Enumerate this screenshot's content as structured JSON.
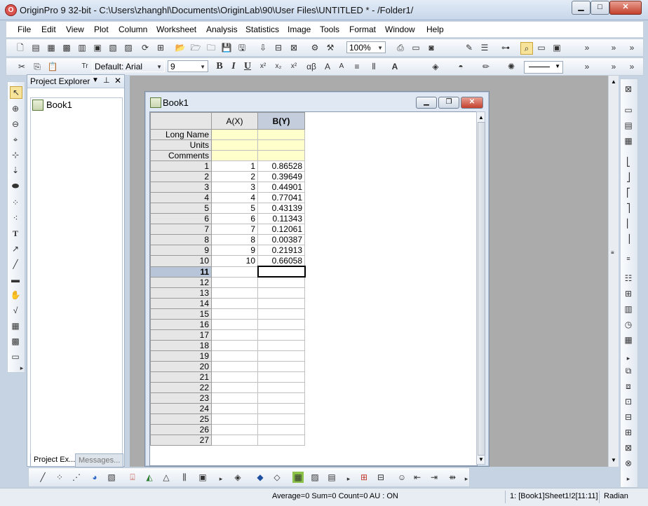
{
  "window": {
    "title": "OriginPro 9 32-bit - C:\\Users\\zhanghl\\Documents\\OriginLab\\90\\User Files\\UNTITLED * - /Folder1/",
    "app_icon_letter": "O",
    "min_label": "▁",
    "max_label": "□",
    "close_label": "✕"
  },
  "menu": [
    "File",
    "Edit",
    "View",
    "Plot",
    "Column",
    "Worksheet",
    "Analysis",
    "Statistics",
    "Image",
    "Tools",
    "Format",
    "Window",
    "Help"
  ],
  "toolbar": {
    "zoom": "100%",
    "font_name": "Default: Arial",
    "font_size": "9",
    "font_icon": "Tr"
  },
  "project_explorer": {
    "title": "Project Explorer",
    "pin": "⊥",
    "close": "✕",
    "items": [
      "Book1"
    ],
    "tabs": [
      "Project Ex...",
      "Messages..."
    ]
  },
  "book": {
    "title": "Book1",
    "columns": [
      {
        "header": "A(X)"
      },
      {
        "header": "B(Y)"
      }
    ],
    "meta_rows": [
      "Long Name",
      "Units",
      "Comments"
    ],
    "rows": [
      {
        "n": "1",
        "a": "1",
        "b": "0.86528"
      },
      {
        "n": "2",
        "a": "2",
        "b": "0.39649"
      },
      {
        "n": "3",
        "a": "3",
        "b": "0.44901"
      },
      {
        "n": "4",
        "a": "4",
        "b": "0.77041"
      },
      {
        "n": "5",
        "a": "5",
        "b": "0.43139"
      },
      {
        "n": "6",
        "a": "6",
        "b": "0.11343"
      },
      {
        "n": "7",
        "a": "7",
        "b": "0.12061"
      },
      {
        "n": "8",
        "a": "8",
        "b": "0.00387"
      },
      {
        "n": "9",
        "a": "9",
        "b": "0.21913"
      },
      {
        "n": "10",
        "a": "10",
        "b": "0.66058"
      },
      {
        "n": "11",
        "a": "",
        "b": ""
      },
      {
        "n": "12",
        "a": "",
        "b": ""
      },
      {
        "n": "13",
        "a": "",
        "b": ""
      },
      {
        "n": "14",
        "a": "",
        "b": ""
      },
      {
        "n": "15",
        "a": "",
        "b": ""
      },
      {
        "n": "16",
        "a": "",
        "b": ""
      },
      {
        "n": "17",
        "a": "",
        "b": ""
      },
      {
        "n": "18",
        "a": "",
        "b": ""
      },
      {
        "n": "19",
        "a": "",
        "b": ""
      },
      {
        "n": "20",
        "a": "",
        "b": ""
      },
      {
        "n": "21",
        "a": "",
        "b": ""
      },
      {
        "n": "22",
        "a": "",
        "b": ""
      },
      {
        "n": "23",
        "a": "",
        "b": ""
      },
      {
        "n": "24",
        "a": "",
        "b": ""
      },
      {
        "n": "25",
        "a": "",
        "b": ""
      },
      {
        "n": "26",
        "a": "",
        "b": ""
      },
      {
        "n": "27",
        "a": "",
        "b": ""
      }
    ]
  },
  "status": {
    "summary": "Average=0 Sum=0 Count=0  AU : ON",
    "location": "1: [Book1]Sheet1!2[11:11]",
    "angle": "Radian"
  },
  "colors": {
    "meta_row_bg": "#ffffcc",
    "selected_column_header": "#c3cddc",
    "current_row_header": "#b8c4d8",
    "workspace": "#ababab"
  }
}
